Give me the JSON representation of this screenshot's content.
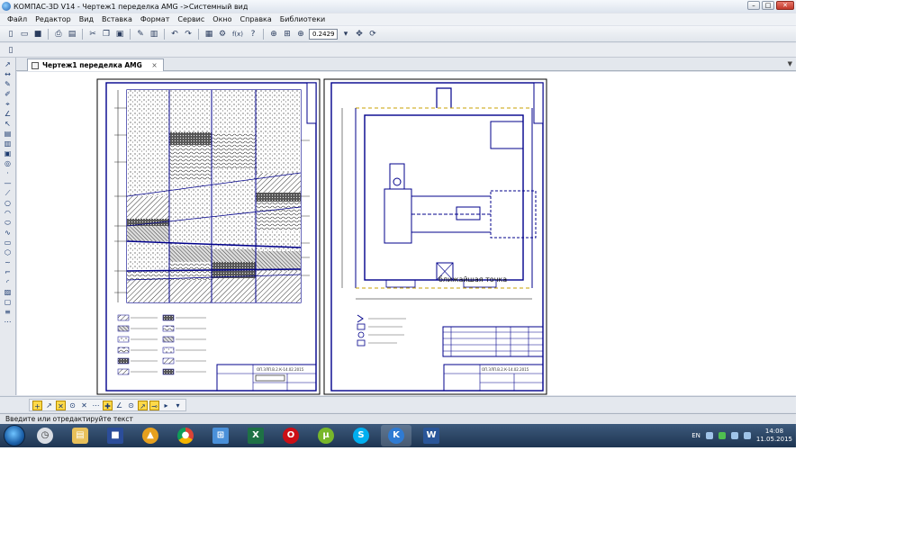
{
  "window": {
    "title": "КОМПАС-3D V14 - Чертеж1 переделка AMG ->Системный вид"
  },
  "menu": [
    "Файл",
    "Редактор",
    "Вид",
    "Вставка",
    "Формат",
    "Сервис",
    "Окно",
    "Справка",
    "Библиотеки"
  ],
  "toolbar": {
    "zoom_value": "0.2429",
    "variables_label": "f(x)"
  },
  "document_tab": {
    "label": "Чертеж1 переделка AMG",
    "close": "×"
  },
  "drawing": {
    "annotation_near_point": "ближайшая точка",
    "sheet1_stamp_code": "ОП.ЗЛП.В.2.К-14.02.2015",
    "sheet2_stamp_code": "ОП.ЗЛП.В.2.К-14.02.2015"
  },
  "status_bar": {
    "text": "Введите или отредактируйте текст"
  },
  "taskbar": {
    "language": "EN",
    "time": "14:08",
    "date": "11.05.2015"
  }
}
